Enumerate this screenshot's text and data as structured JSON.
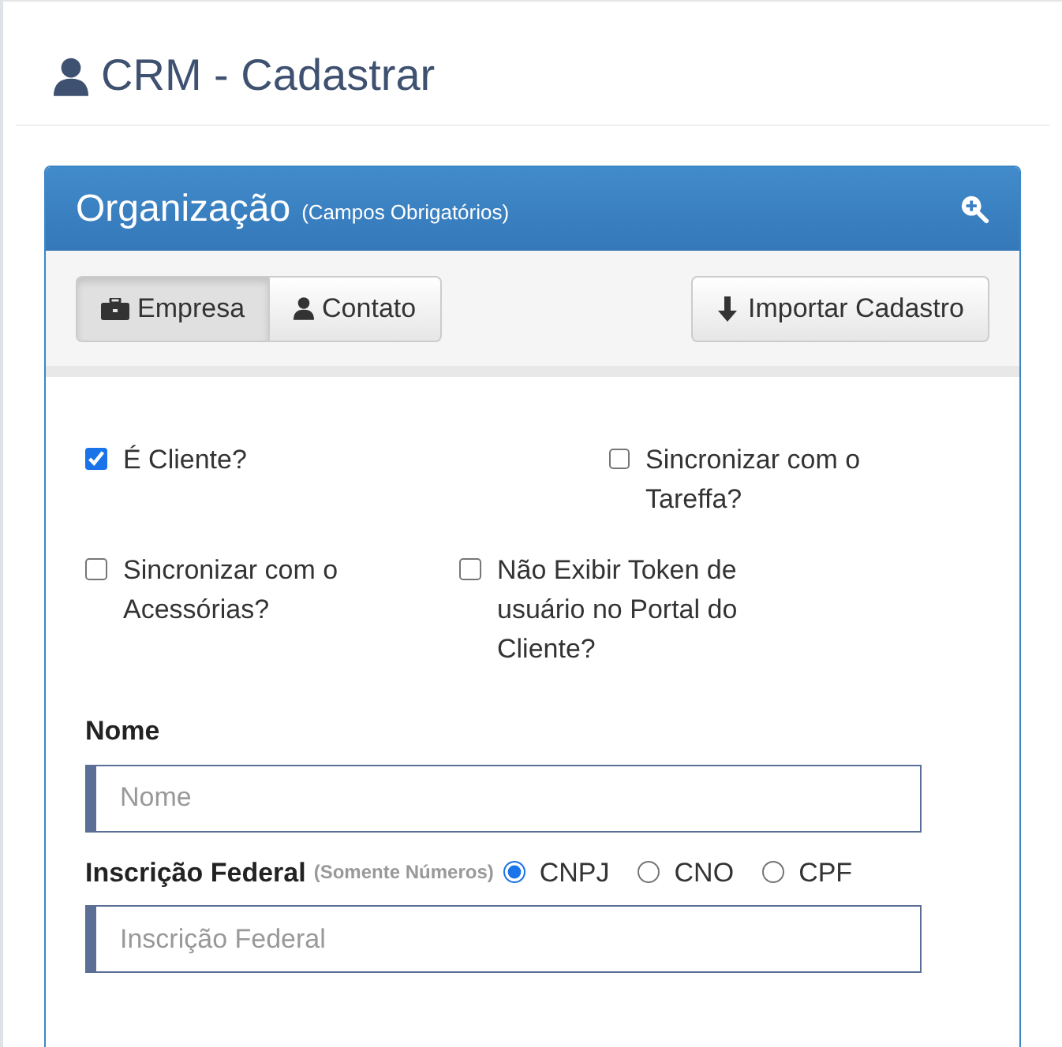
{
  "page_title": "CRM - Cadastrar",
  "panel": {
    "title": "Organização",
    "subtitle": "(Campos Obrigatórios)",
    "tabs": [
      {
        "label": "Empresa",
        "kind": "briefcase",
        "selected": true
      },
      {
        "label": "Contato",
        "kind": "person",
        "selected": false
      }
    ],
    "import_button": "Importar Cadastro",
    "options": [
      {
        "label": "É Cliente?",
        "checked": true
      },
      {
        "label": "Sincronizar com o Tareffa?",
        "checked": false
      },
      {
        "label": "Sincronizar com o Acessórias?",
        "checked": false
      },
      {
        "label": "Não Exibir Token de usuário no Portal do Cliente?",
        "checked": false
      }
    ],
    "fields": [
      {
        "label": "Nome",
        "placeholder": "Nome"
      },
      {
        "label": "Inscrição Federal",
        "hint": "(Somente Números)",
        "placeholder": "Inscrição Federal",
        "radios": [
          {
            "label": "CNPJ",
            "selected": true
          },
          {
            "label": "CNO",
            "selected": false
          },
          {
            "label": "CPF",
            "selected": false
          }
        ]
      }
    ]
  }
}
